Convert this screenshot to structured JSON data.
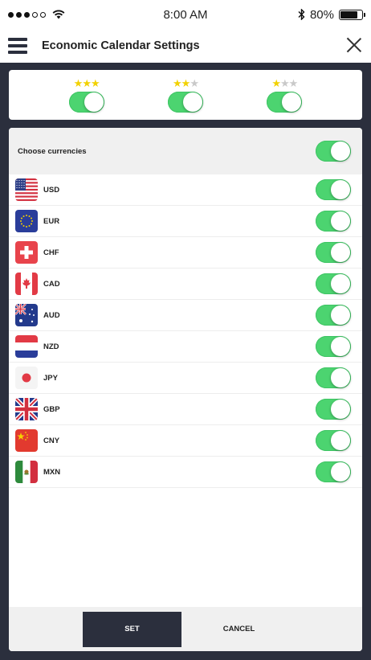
{
  "status_bar": {
    "time": "8:00 AM",
    "battery_percent": "80%",
    "battery_level": 0.8
  },
  "header": {
    "title": "Economic Calendar Settings"
  },
  "impact_filters": [
    {
      "stars_filled": 3,
      "stars_total": 3,
      "enabled": true,
      "icon": "star-icon"
    },
    {
      "stars_filled": 2,
      "stars_total": 3,
      "enabled": true,
      "icon": "star-icon"
    },
    {
      "stars_filled": 1,
      "stars_total": 3,
      "enabled": true,
      "icon": "star-icon"
    }
  ],
  "currencies_section": {
    "label": "Choose currencies",
    "enabled": true,
    "items": [
      {
        "code": "USD",
        "flag": "us-flag-icon",
        "enabled": true
      },
      {
        "code": "EUR",
        "flag": "eu-flag-icon",
        "enabled": true
      },
      {
        "code": "CHF",
        "flag": "ch-flag-icon",
        "enabled": true
      },
      {
        "code": "CAD",
        "flag": "ca-flag-icon",
        "enabled": true
      },
      {
        "code": "AUD",
        "flag": "au-flag-icon",
        "enabled": true
      },
      {
        "code": "NZD",
        "flag": "nz-flag-icon",
        "enabled": true
      },
      {
        "code": "JPY",
        "flag": "jp-flag-icon",
        "enabled": true
      },
      {
        "code": "GBP",
        "flag": "gb-flag-icon",
        "enabled": true
      },
      {
        "code": "CNY",
        "flag": "cn-flag-icon",
        "enabled": true
      },
      {
        "code": "MXN",
        "flag": "mx-flag-icon",
        "enabled": true
      }
    ]
  },
  "footer": {
    "set_label": "SET",
    "cancel_label": "CANCEL"
  },
  "colors": {
    "toggle_on": "#4cd470",
    "dark": "#2b2f3d",
    "star_on": "#f2d100",
    "star_off": "#c9c9c9"
  }
}
